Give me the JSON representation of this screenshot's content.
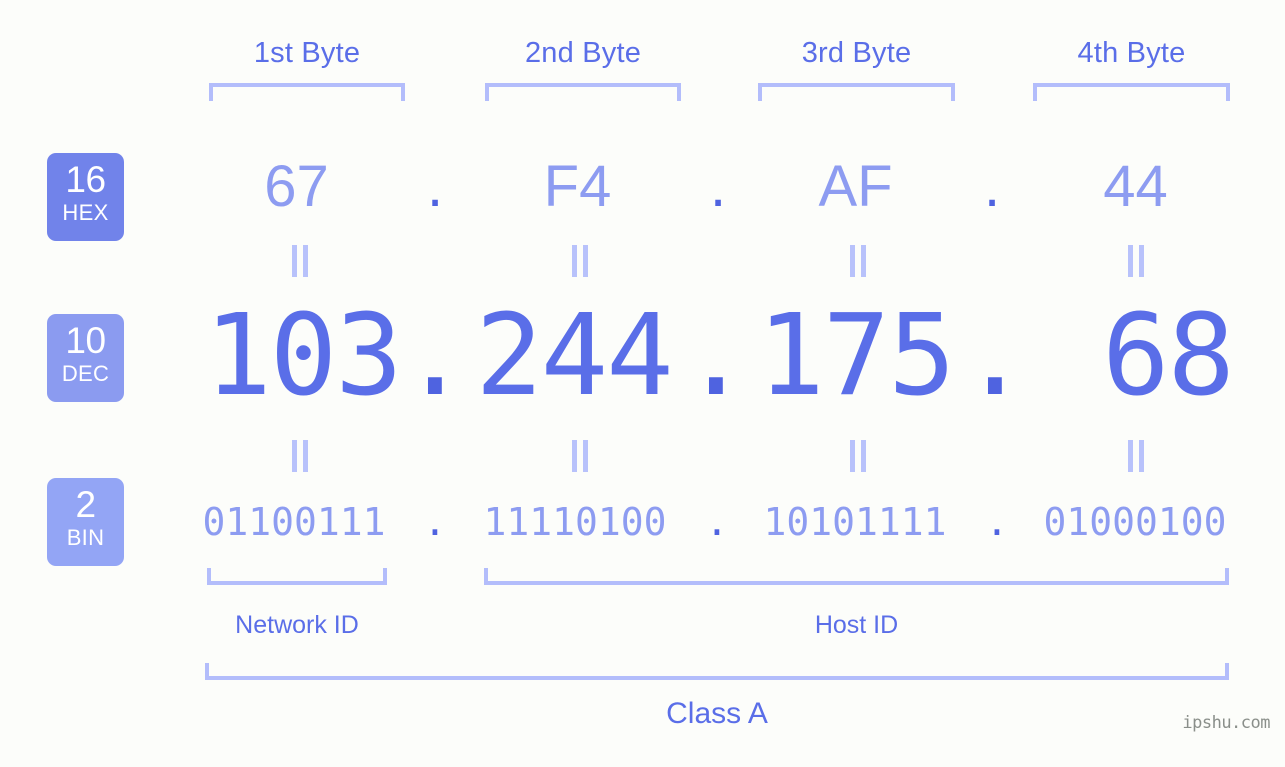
{
  "meta": {
    "background_color": "#fcfdfa",
    "accent_color": "#5a6ee8",
    "light_accent_color": "#8d9cf1",
    "bracket_color": "#b3bdfb"
  },
  "byte_headers": [
    {
      "label": "1st Byte"
    },
    {
      "label": "2nd Byte"
    },
    {
      "label": "3rd Byte"
    },
    {
      "label": "4th Byte"
    }
  ],
  "radix_badges": [
    {
      "number": "16",
      "name": "HEX",
      "color": "#7183ea"
    },
    {
      "number": "10",
      "name": "DEC",
      "color": "#8b9bf0"
    },
    {
      "number": "2",
      "name": "BIN",
      "color": "#93a5f5"
    }
  ],
  "rows": {
    "hex": {
      "values": [
        "67",
        "F4",
        "AF",
        "44"
      ],
      "separators": [
        ".",
        ".",
        "."
      ]
    },
    "dec": {
      "values": [
        "103",
        "244",
        "175",
        "68"
      ],
      "separators": [
        ".",
        ".",
        "."
      ]
    },
    "bin": {
      "values": [
        "01100111",
        "11110100",
        "10101111",
        "01000100"
      ],
      "separators": [
        ".",
        ".",
        "."
      ]
    }
  },
  "equals_marks": {
    "label": "=",
    "count_hex_to_dec": 4,
    "count_dec_to_bin": 4
  },
  "sections": [
    {
      "label": "Network ID"
    },
    {
      "label": "Host ID"
    }
  ],
  "class": {
    "label": "Class A"
  },
  "watermark": {
    "text": "ipshu.com"
  }
}
